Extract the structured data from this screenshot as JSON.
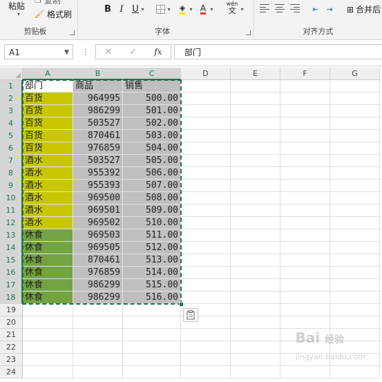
{
  "ribbon": {
    "clipboard": {
      "label": "剪贴板",
      "paste": "粘贴",
      "copy": "复制",
      "format_painter": "格式刷"
    },
    "font": {
      "label": "字体",
      "bold": "B",
      "italic": "I",
      "underline": "U",
      "wen": "wén",
      "wen_char": "文"
    },
    "alignment": {
      "label": "对齐方式",
      "merge": "合并后"
    }
  },
  "formula_bar": {
    "name_box": "A1",
    "formula": "部门",
    "fx": "fx",
    "cancel": "✕",
    "enter": "✓",
    "more": "⋮"
  },
  "columns": [
    "A",
    "B",
    "C",
    "D",
    "E",
    "F",
    "G"
  ],
  "rows": [
    "1",
    "2",
    "3",
    "4",
    "5",
    "6",
    "7",
    "8",
    "9",
    "10",
    "11",
    "12",
    "13",
    "14",
    "15",
    "16",
    "17",
    "18",
    "19",
    "20",
    "21",
    "22",
    "23",
    "24"
  ],
  "table": {
    "header": [
      "部门",
      "商品",
      "销售"
    ],
    "rows": [
      [
        "百货",
        "964995",
        "500.00"
      ],
      [
        "百货",
        "986299",
        "501.00"
      ],
      [
        "百货",
        "503527",
        "502.00"
      ],
      [
        "百货",
        "870461",
        "503.00"
      ],
      [
        "百货",
        "976859",
        "504.00"
      ],
      [
        "酒水",
        "503527",
        "505.00"
      ],
      [
        "酒水",
        "955392",
        "506.00"
      ],
      [
        "酒水",
        "955393",
        "507.00"
      ],
      [
        "酒水",
        "969500",
        "508.00"
      ],
      [
        "酒水",
        "969501",
        "509.00"
      ],
      [
        "酒水",
        "969502",
        "510.00"
      ],
      [
        "休食",
        "969503",
        "511.00"
      ],
      [
        "休食",
        "969505",
        "512.00"
      ],
      [
        "休食",
        "870461",
        "513.00"
      ],
      [
        "休食",
        "976859",
        "514.00"
      ],
      [
        "休食",
        "986299",
        "515.00"
      ],
      [
        "休食",
        "986299",
        "516.00"
      ]
    ]
  },
  "colors": {
    "yellow": "#c7c700",
    "green": "#73a343",
    "gray": "#bfbfbf",
    "accent": "#217346"
  },
  "watermark": {
    "brand": "Bai",
    "suffix": "经验",
    "url": "jingyan.baidu.com"
  }
}
